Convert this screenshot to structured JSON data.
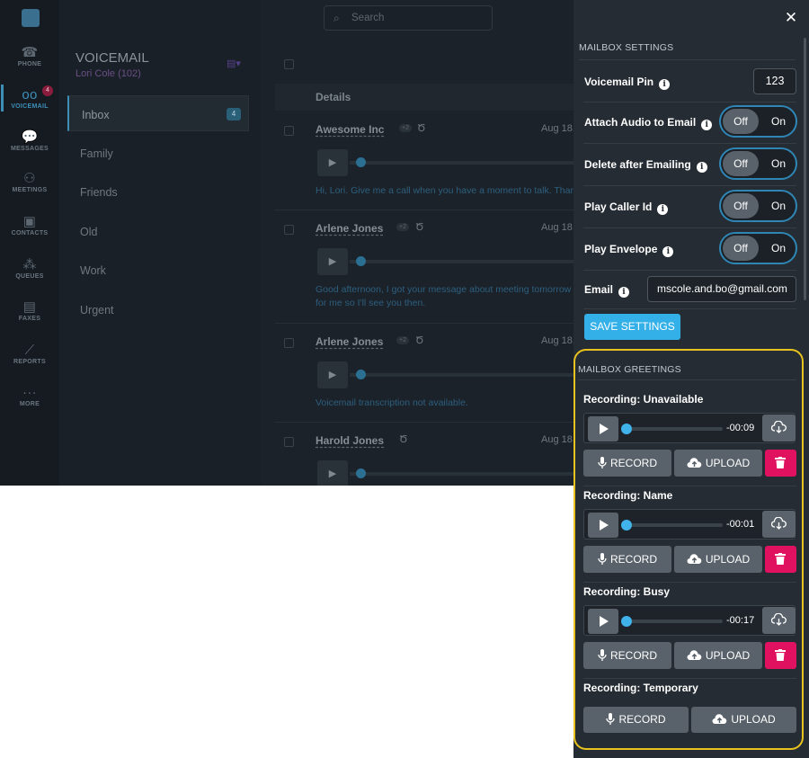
{
  "rail": {
    "items": [
      {
        "label": "PHONE",
        "icon": "phone-icon"
      },
      {
        "label": "VOICEMAIL",
        "icon": "voicemail-icon",
        "badge": "4"
      },
      {
        "label": "MESSAGES",
        "icon": "messages-icon"
      },
      {
        "label": "MEETINGS",
        "icon": "meetings-icon"
      },
      {
        "label": "CONTACTS",
        "icon": "contacts-icon"
      },
      {
        "label": "QUEUES",
        "icon": "queues-icon"
      },
      {
        "label": "FAXES",
        "icon": "faxes-icon"
      },
      {
        "label": "REPORTS",
        "icon": "reports-icon"
      },
      {
        "label": "MORE",
        "icon": "more-icon"
      }
    ]
  },
  "voicemail": {
    "title": "VOICEMAIL",
    "user": "Lori Cole (102)",
    "folders": [
      {
        "label": "Inbox",
        "count": "4"
      },
      {
        "label": "Family"
      },
      {
        "label": "Friends"
      },
      {
        "label": "Old"
      },
      {
        "label": "Work"
      },
      {
        "label": "Urgent"
      }
    ]
  },
  "search": {
    "placeholder": "Search"
  },
  "list": {
    "header": "Details",
    "items": [
      {
        "name": "Awesome Inc",
        "plus": "+2",
        "date": "Aug 18,",
        "transcript": [
          "Hi, Lori. Give me a call when you have a moment to talk. Thank"
        ]
      },
      {
        "name": "Arlene Jones",
        "plus": "+2",
        "date": "Aug 18,",
        "transcript": [
          "Good afternoon, I got your message about meeting tomorrow",
          "for me so I'll see you then."
        ]
      },
      {
        "name": "Arlene Jones",
        "plus": "+2",
        "date": "Aug 18,",
        "transcript": [
          "Voicemail transcription not available."
        ]
      },
      {
        "name": "Harold Jones",
        "date": "Aug 18,",
        "transcript": []
      }
    ]
  },
  "settings": {
    "section_title": "MAILBOX SETTINGS",
    "pin_label": "Voicemail Pin",
    "pin_value": "123",
    "toggles": [
      {
        "label": "Attach Audio to Email",
        "off": "Off",
        "on": "On",
        "value": "Off"
      },
      {
        "label": "Delete after Emailing",
        "off": "Off",
        "on": "On",
        "value": "Off"
      },
      {
        "label": "Play Caller Id",
        "off": "Off",
        "on": "On",
        "value": "Off"
      },
      {
        "label": "Play Envelope",
        "off": "Off",
        "on": "On",
        "value": "Off"
      }
    ],
    "email_label": "Email",
    "email_value": "mscole.and.bo@gmail.com",
    "save_label": "SAVE SETTINGS"
  },
  "greetings": {
    "section_title": "MAILBOX GREETINGS",
    "record_label": "RECORD",
    "upload_label": "UPLOAD",
    "recordings": [
      {
        "title": "Recording: Unavailable",
        "time": "-00:09",
        "progress": 0
      },
      {
        "title": "Recording: Name",
        "time": "-00:01",
        "progress": 0
      },
      {
        "title": "Recording: Busy",
        "time": "-00:17",
        "progress": 0
      },
      {
        "title": "Recording: Temporary"
      }
    ]
  },
  "colors": {
    "accent": "#33b0e8",
    "delete": "#e0115e",
    "highlight_frame": "#e8c21e",
    "panel_bg": "#252c33"
  }
}
